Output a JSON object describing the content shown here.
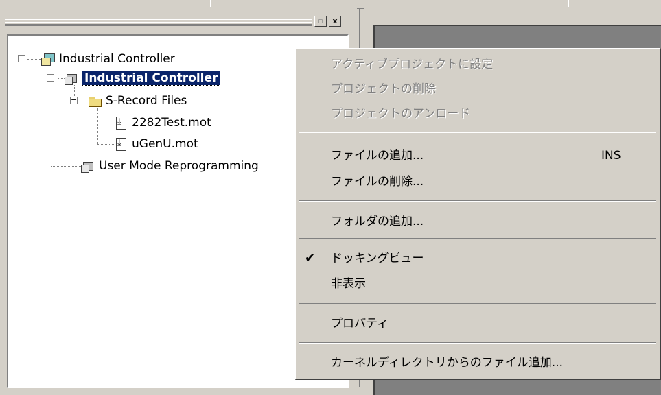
{
  "panel": {
    "restore_btn": "▫",
    "close_btn": "x"
  },
  "tree": {
    "root_label": "Industrial Controller",
    "project_label": "Industrial Controller",
    "folder_label": "S-Record Files",
    "file1_label": "2282Test.mot",
    "file2_label": "uGenU.mot",
    "project2_label": "User Mode Reprogramming"
  },
  "menu": {
    "set_active": "アクティブプロジェクトに設定",
    "delete_project": "プロジェクトの削除",
    "unload_project": "プロジェクトのアンロード",
    "add_file": "ファイルの追加...",
    "add_file_shortcut": "INS",
    "delete_file": "ファイルの削除...",
    "add_folder": "フォルダの追加...",
    "docking_view": "ドッキングビュー",
    "docking_check": "✔",
    "hide": "非表示",
    "properties": "プロパティ",
    "add_from_kernel": "カーネルディレクトリからのファイル追加..."
  },
  "icons": {
    "root": "workspace-icon",
    "project": "project-icon",
    "folder": "folder-icon",
    "file": "mot-file-icon"
  }
}
